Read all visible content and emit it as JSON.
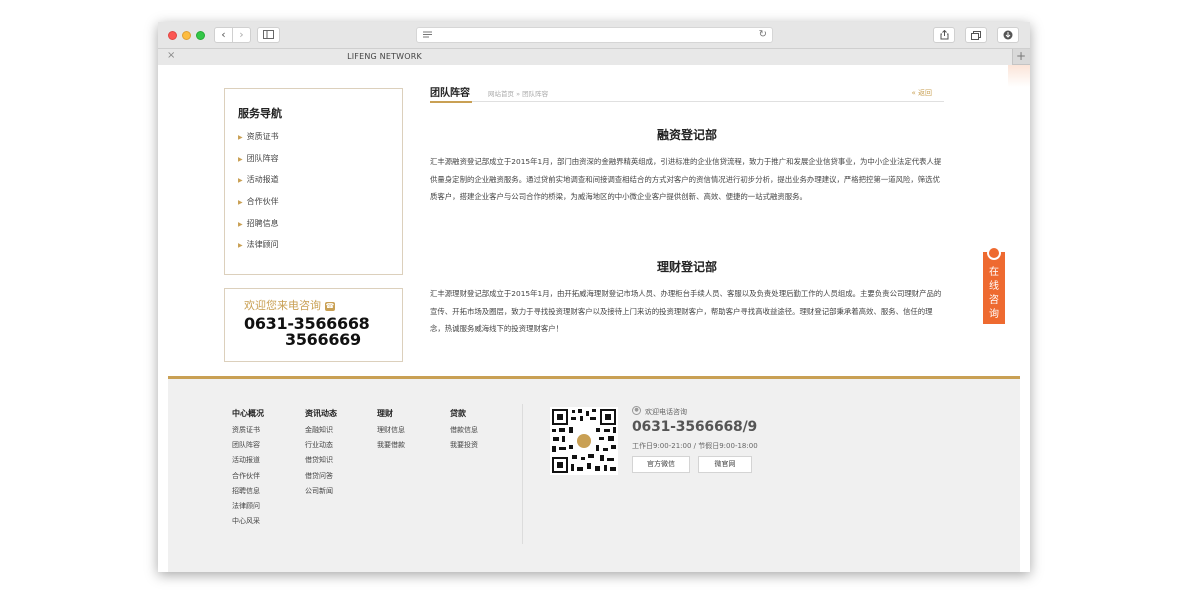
{
  "browser": {
    "tab_title": "LIFENG NETWORK",
    "tab_close": "×",
    "tab_add": "+",
    "back": "‹",
    "forward": "›"
  },
  "sidebar": {
    "title": "服务导航",
    "items": [
      {
        "label": "资质证书"
      },
      {
        "label": "团队阵容"
      },
      {
        "label": "活动报道"
      },
      {
        "label": "合作伙伴"
      },
      {
        "label": "招聘信息"
      },
      {
        "label": "法律顾问"
      }
    ]
  },
  "contact_box": {
    "title": "欢迎您来电咨询",
    "phone_1": "0631-3566668",
    "phone_2": "3566669"
  },
  "breadcrumb": {
    "title": "团队阵容",
    "path": "网站首页 » 团队阵容",
    "back": "« 返回"
  },
  "sections": [
    {
      "title": "融资登记部",
      "body": "汇丰源融资登记部成立于2015年1月，部门由资深的金融界精英组成，引进标准的企业信贷流程，致力于推广和发展企业信贷事业，为中小企业法定代表人提供量身定制的企业融资服务。通过贷前实地调查和间接调查相结合的方式对客户的资信情况进行初步分析，提出业务办理建议，严格把控第一道风险，筛选优质客户，搭建企业客户与公司合作的桥梁，为威海地区的中小微企业客户提供创新、高效、便捷的一站式融资服务。"
    },
    {
      "title": "理财登记部",
      "body": "汇丰源理财登记部成立于2015年1月，由开拓威海理财登记市场人员、办理柜台手续人员、客服以及负责处理后勤工作的人员组成。主要负责公司理财产品的宣传、开拓市场及圈层，致力于寻找投资理财客户以及接待上门来访的投资理财客户，帮助客户寻找高收益途径。理财登记部秉承着高效、服务、信任的理念，热诚服务威海线下的投资理财客户！"
    }
  ],
  "float_consult": {
    "label": "在线咨询"
  },
  "footer": {
    "columns": [
      {
        "title": "中心概况",
        "links": [
          "资质证书",
          "团队阵容",
          "活动报道",
          "合作伙伴",
          "招聘信息",
          "法律顾问",
          "中心风采"
        ]
      },
      {
        "title": "资讯动态",
        "links": [
          "金融知识",
          "行业动态",
          "借贷知识",
          "借贷问答",
          "公司新闻"
        ]
      },
      {
        "title": "理财",
        "links": [
          "理财信息",
          "我要借款"
        ]
      },
      {
        "title": "贷款",
        "links": [
          "借款信息",
          "我要投资"
        ]
      }
    ],
    "contact_label": "欢迎电话咨询",
    "phone": "0631-3566668/9",
    "hours": "工作日9:00-21:00 / 节假日9:00-18:00",
    "button_wechat": "官方微信",
    "button_mobile": "微官网"
  },
  "colors": {
    "accent_gold": "#c9a054",
    "consult_orange": "#ee6a30"
  }
}
